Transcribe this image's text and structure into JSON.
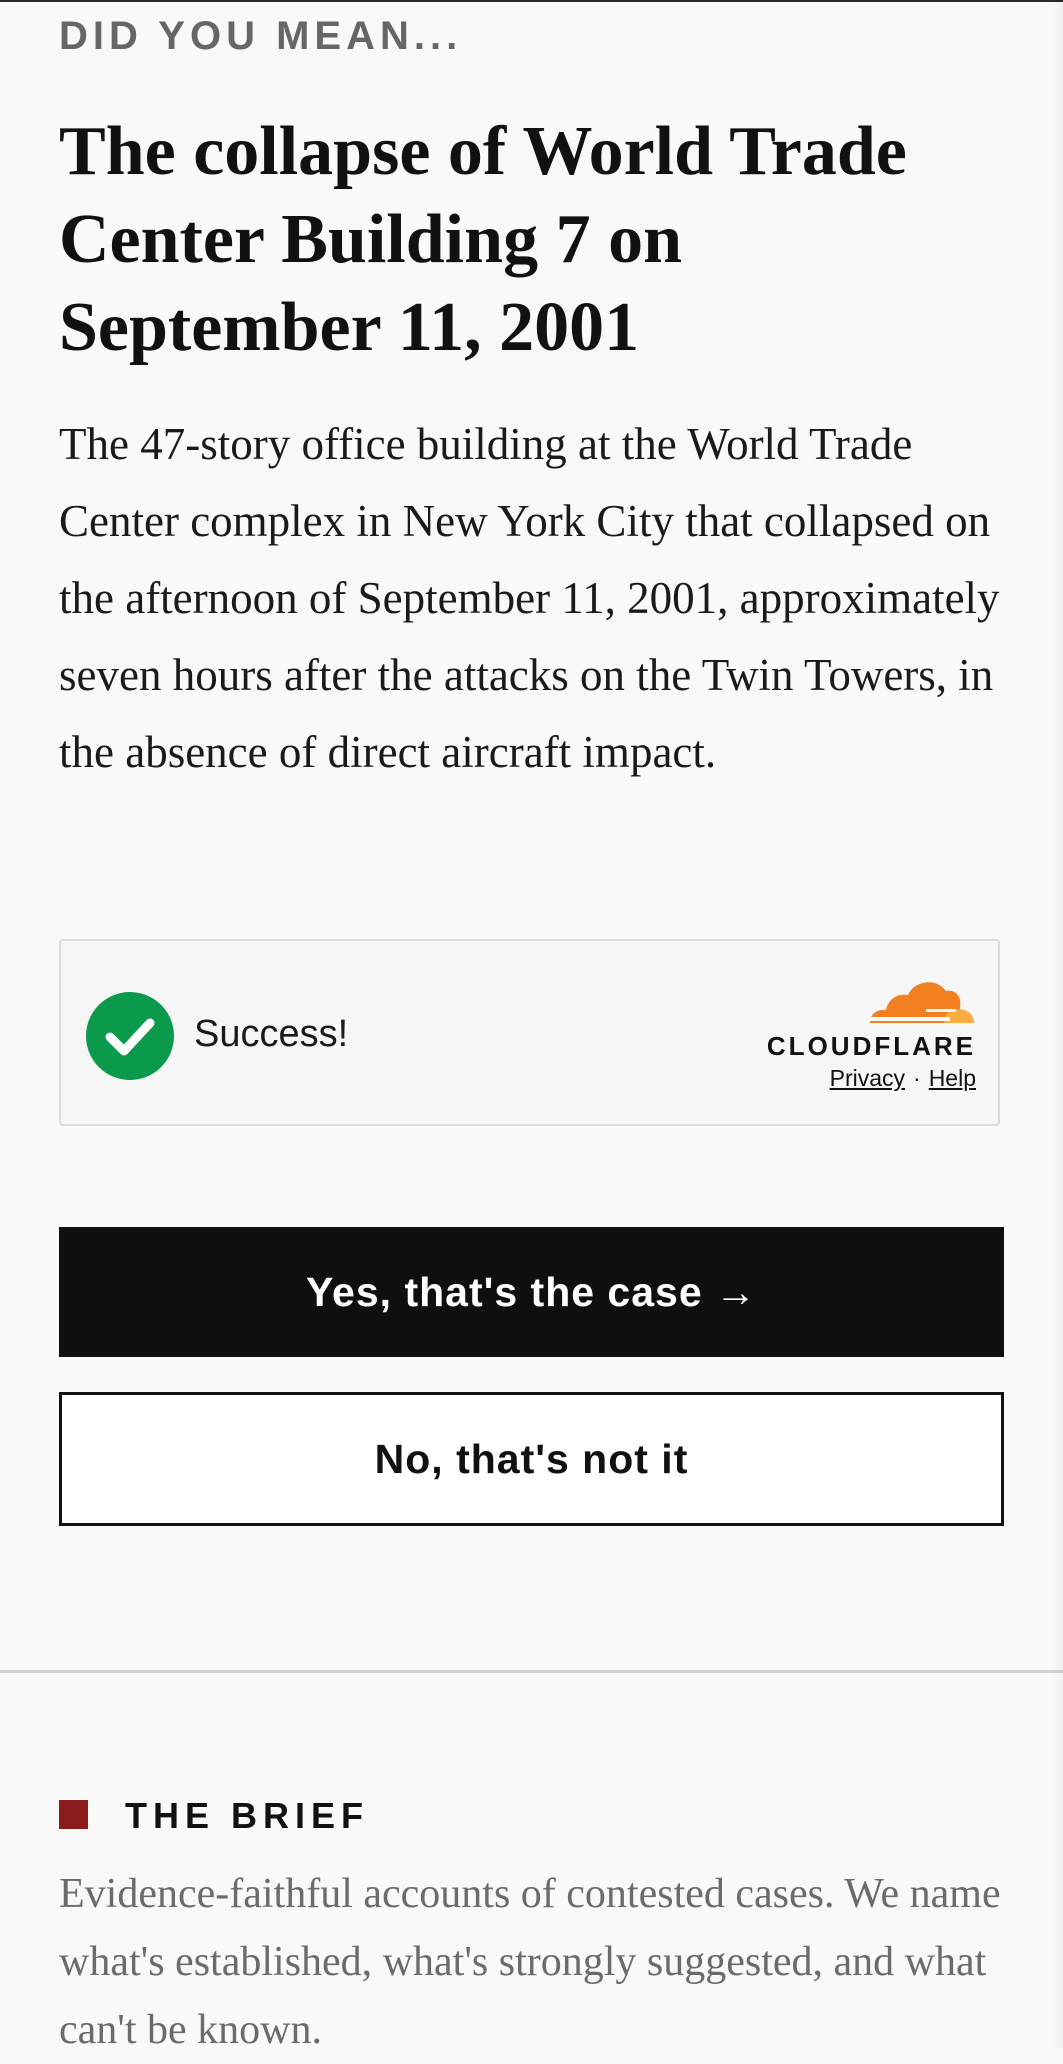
{
  "prompt": {
    "eyebrow": "DID YOU MEAN...",
    "title": "The collapse of World Trade Center Building 7 on September 11, 2001",
    "description": "The 47-story office building at the World Trade Center complex in New York City that collapsed on the afternoon of September 11, 2001, approximately seven hours after the attacks on the Twin Towers, in the absence of direct aircraft impact."
  },
  "captcha": {
    "status": "Success!",
    "provider": "CLOUDFLARE",
    "privacy_link": "Privacy",
    "separator": "·",
    "help_link": "Help",
    "colors": {
      "success_green": "#0b9a4b",
      "cloud_orange": "#f38020",
      "cloud_light": "#fbad41"
    },
    "icons": [
      "check-circle-icon",
      "cloudflare-logo-icon"
    ]
  },
  "actions": {
    "confirm_label": "Yes, that's the case →",
    "reject_label": "No, that's not it"
  },
  "brief": {
    "heading": "THE BRIEF",
    "text": "Evidence-faithful accounts of contested cases. We name what's established, what's strongly suggested, and what can't be known.",
    "accent_color": "#8b1a1a"
  }
}
